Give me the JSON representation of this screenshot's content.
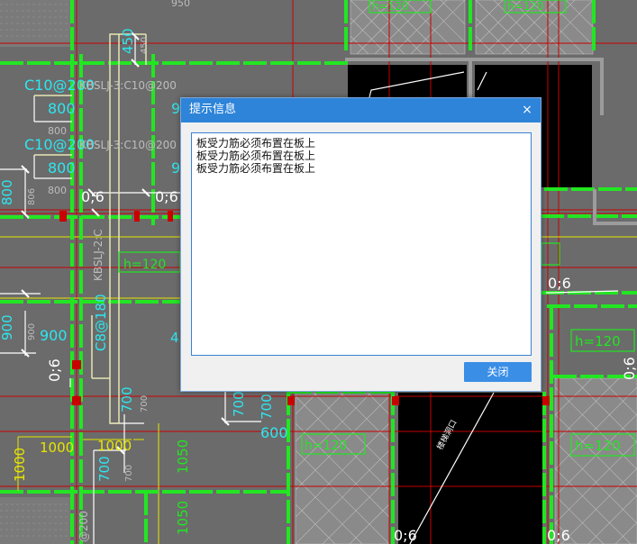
{
  "cad_labels": [
    {
      "id": "lbl-950",
      "text": "950"
    },
    {
      "id": "lbl-h120-top1",
      "text": "h=120"
    },
    {
      "id": "lbl-h120-top2",
      "text": "h=120"
    },
    {
      "id": "lbl-450",
      "text": "450"
    },
    {
      "id": "lbl-450b",
      "text": "450"
    },
    {
      "id": "lbl-c10a",
      "text": "C10@200"
    },
    {
      "id": "lbl-kbslj-a",
      "text": "KBSLJ-3:C10@200"
    },
    {
      "id": "lbl-800a",
      "text": "800"
    },
    {
      "id": "lbl-800a-dim",
      "text": "800"
    },
    {
      "id": "lbl-9a",
      "text": "9"
    },
    {
      "id": "lbl-c10b",
      "text": "C10@200"
    },
    {
      "id": "lbl-kbslj-b",
      "text": "KBSLJ-3:C10@200"
    },
    {
      "id": "lbl-800b",
      "text": "800"
    },
    {
      "id": "lbl-800b-dim",
      "text": "800"
    },
    {
      "id": "lbl-9b",
      "text": "9"
    },
    {
      "id": "lbl-800-left",
      "text": "800"
    },
    {
      "id": "lbl-806",
      "text": "806"
    },
    {
      "id": "lbl-06a",
      "text": "0;6"
    },
    {
      "id": "lbl-06b",
      "text": "0;6"
    },
    {
      "id": "lbl-kbslj-vert",
      "text": "KBSLJ-2:C"
    },
    {
      "id": "lbl-h120-left",
      "text": "h=120"
    },
    {
      "id": "lbl-900-left",
      "text": "900"
    },
    {
      "id": "lbl-900-left-dim",
      "text": "900"
    },
    {
      "id": "lbl-900-mid",
      "text": "900"
    },
    {
      "id": "lbl-c8",
      "text": "C8@180"
    },
    {
      "id": "lbl-45",
      "text": "45"
    },
    {
      "id": "lbl-06-left",
      "text": "0;6"
    },
    {
      "id": "lbl-700a",
      "text": "700"
    },
    {
      "id": "lbl-700a-dim",
      "text": "700"
    },
    {
      "id": "lbl-700b",
      "text": "700"
    },
    {
      "id": "lbl-700c",
      "text": "700"
    },
    {
      "id": "lbl-600",
      "text": "600"
    },
    {
      "id": "lbl-1000a",
      "text": "1000"
    },
    {
      "id": "lbl-1000b",
      "text": "1000"
    },
    {
      "id": "lbl-1000-vert",
      "text": "1000"
    },
    {
      "id": "lbl-700d",
      "text": "700"
    },
    {
      "id": "lbl-700d-dim",
      "text": "700"
    },
    {
      "id": "lbl-1050a",
      "text": "1050"
    },
    {
      "id": "lbl-1050b",
      "text": "1050"
    },
    {
      "id": "lbl-200",
      "text": "@200"
    },
    {
      "id": "lbl-h120-mid",
      "text": "h=120"
    },
    {
      "id": "lbl-06-right",
      "text": "0;6"
    },
    {
      "id": "lbl-h120-right1",
      "text": "h=120"
    },
    {
      "id": "lbl-h120-right2",
      "text": "h=120"
    },
    {
      "id": "lbl-06-far",
      "text": "0;6"
    },
    {
      "id": "lbl-06-bottom1",
      "text": "0;6"
    },
    {
      "id": "lbl-06-bottom2",
      "text": "0;6"
    },
    {
      "id": "lbl-stair",
      "text": "楼梯洞口"
    }
  ],
  "dialog": {
    "title": "提示信息",
    "close_symbol": "×",
    "messages": [
      "板受力筋必须布置在板上",
      "板受力筋必须布置在板上",
      "板受力筋必须布置在板上"
    ],
    "close_button_label": "关闭"
  },
  "colors": {
    "background": "#6b6b6b",
    "wall_green": "#22e622",
    "grid_red": "#c80000",
    "dim_white": "#ffffff",
    "cyan_text": "#2ee6f0",
    "yellow_line": "#e6e600",
    "title_bar": "#2d84d9",
    "button": "#3a8ee6"
  }
}
